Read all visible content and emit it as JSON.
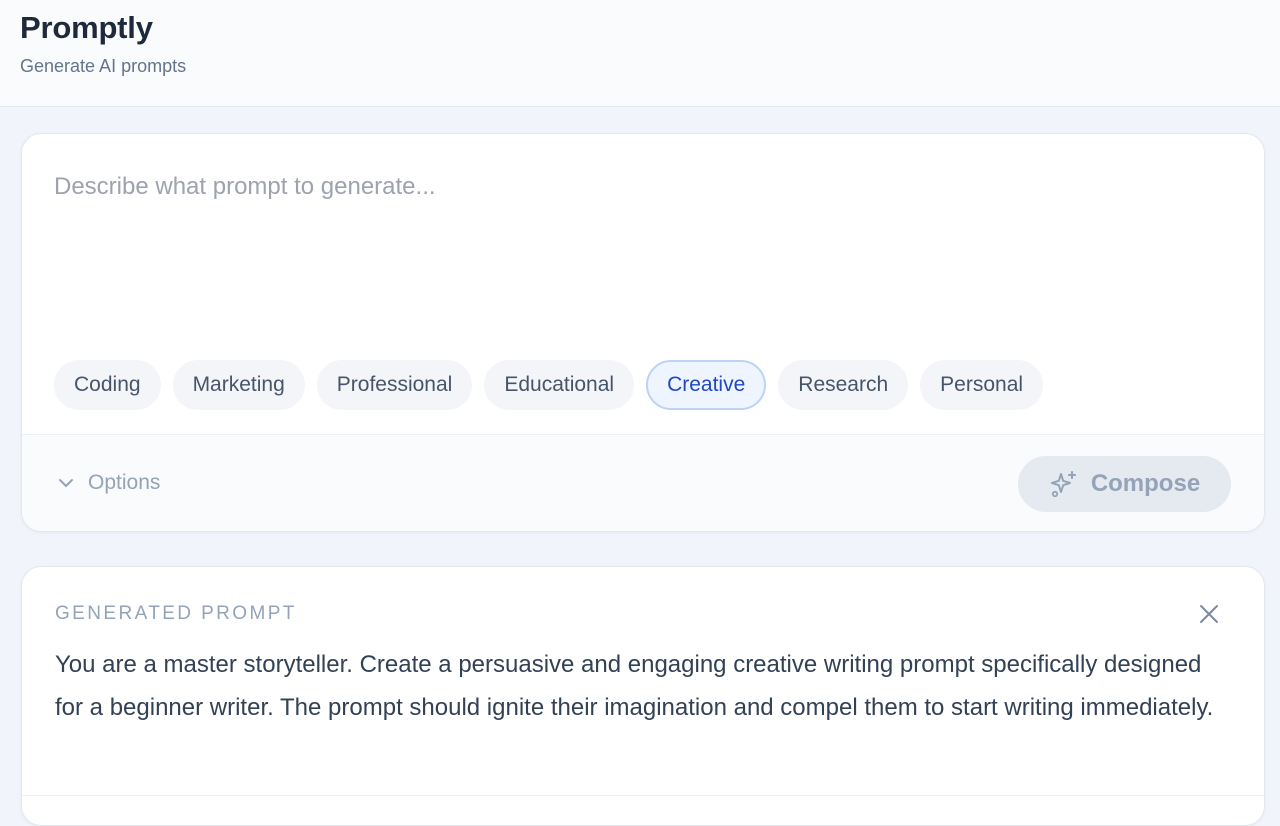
{
  "app": {
    "title": "Promptly",
    "subtitle": "Generate AI prompts"
  },
  "composer": {
    "input_value": "",
    "placeholder": "Describe what prompt to generate...",
    "categories": [
      {
        "label": "Coding",
        "active": false
      },
      {
        "label": "Marketing",
        "active": false
      },
      {
        "label": "Professional",
        "active": false
      },
      {
        "label": "Educational",
        "active": false
      },
      {
        "label": "Creative",
        "active": true
      },
      {
        "label": "Research",
        "active": false
      },
      {
        "label": "Personal",
        "active": false
      }
    ],
    "options_label": "Options",
    "compose_label": "Compose"
  },
  "result": {
    "label": "GENERATED PROMPT",
    "text": "You are a master storyteller. Create a persuasive and engaging creative writing prompt specifically designed for a beginner writer. The prompt should ignite their imagination and compel them to start writing immediately."
  },
  "colors": {
    "accent": "#2147c4",
    "active_chip_bg": "#eff5ff",
    "active_chip_border": "#bdd3f3",
    "page_bg": "#f1f5fb"
  },
  "icons": {
    "options": "chevron-down-icon",
    "compose": "sparkles-icon",
    "close": "close-icon"
  }
}
